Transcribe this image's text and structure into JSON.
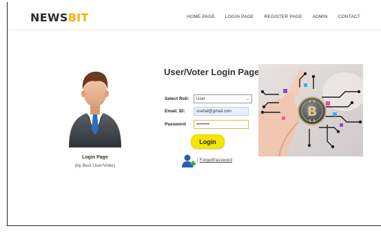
{
  "brand": {
    "part1": "NEWS",
    "part2": "BIT",
    "accent": "#f0b400"
  },
  "nav": {
    "items": [
      "HOME PAGE",
      "LOGIN PAGE",
      "REGISTER PAGE",
      "ADMIN",
      "CONTACT"
    ]
  },
  "profile": {
    "title": "Login Page",
    "subtitle": "(by Best User/Voter)"
  },
  "form": {
    "title": "User/Voter Login Page",
    "role_label": "Select Roll:",
    "role_value": "User",
    "email_label": "Email_ID:",
    "email_value": "snehal@gmail.com",
    "password_label": "Password",
    "password_value": "•••••••••",
    "login_label": "Login",
    "forgot_prefix": "|",
    "forgot_label": "ForgetPassword"
  },
  "colors": {
    "login_button": "#f5e600",
    "password_focus": "#e0b84a",
    "email_autofill": "#e8f0fe"
  },
  "icons": [
    "user-avatar",
    "add-user-icon",
    "bitcoin-circuit-image"
  ]
}
